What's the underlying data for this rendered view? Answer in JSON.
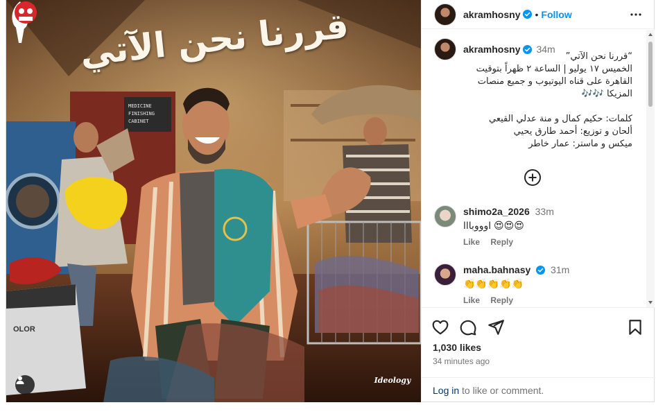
{
  "post": {
    "poster_title": "قررنا نحن الآتي",
    "logo_text": "Ideology",
    "author": {
      "username": "akramhosny",
      "verified": true,
      "follow_label": "Follow"
    },
    "caption": {
      "time": "34m",
      "lines": [
        "“قررنا نحن الآتي”",
        "الخميس ١٧ يوليو | الساعة ٢ ظهراً بتوقيت القاهرة على قناه اليوتيوب و جميع منصات",
        "المزيكا 🎶🎶",
        "",
        "كلمات: حكيم كمال و منة عدلي القيعي",
        "ألحان و توزيع: أحمد طارق يحيي",
        "ميكس و ماستر: عمار خاطر"
      ]
    },
    "comments": [
      {
        "username": "shimo2a_2026",
        "verified": false,
        "time": "33m",
        "text": "اوووبااا 😍😍😍",
        "like_label": "Like",
        "reply_label": "Reply"
      },
      {
        "username": "maha.bahnasy",
        "verified": true,
        "time": "31m",
        "text": "👏👏👏👏👏",
        "like_label": "Like",
        "reply_label": "Reply"
      }
    ],
    "likes": "1,030 likes",
    "posted_ago": "34 minutes ago",
    "login": {
      "link": "Log in",
      "rest": " to like or comment."
    }
  },
  "icons": {
    "more": "more-horizontal-icon",
    "verified": "verified-badge-icon",
    "load_more": "plus-circle-icon",
    "like": "heart-icon",
    "comment": "comment-icon",
    "share": "send-icon",
    "save": "bookmark-icon",
    "tag": "user-tag-icon"
  },
  "colors": {
    "accent": "#0095f6",
    "link": "#00376b",
    "muted": "#737373",
    "verified": "#0095f6"
  }
}
